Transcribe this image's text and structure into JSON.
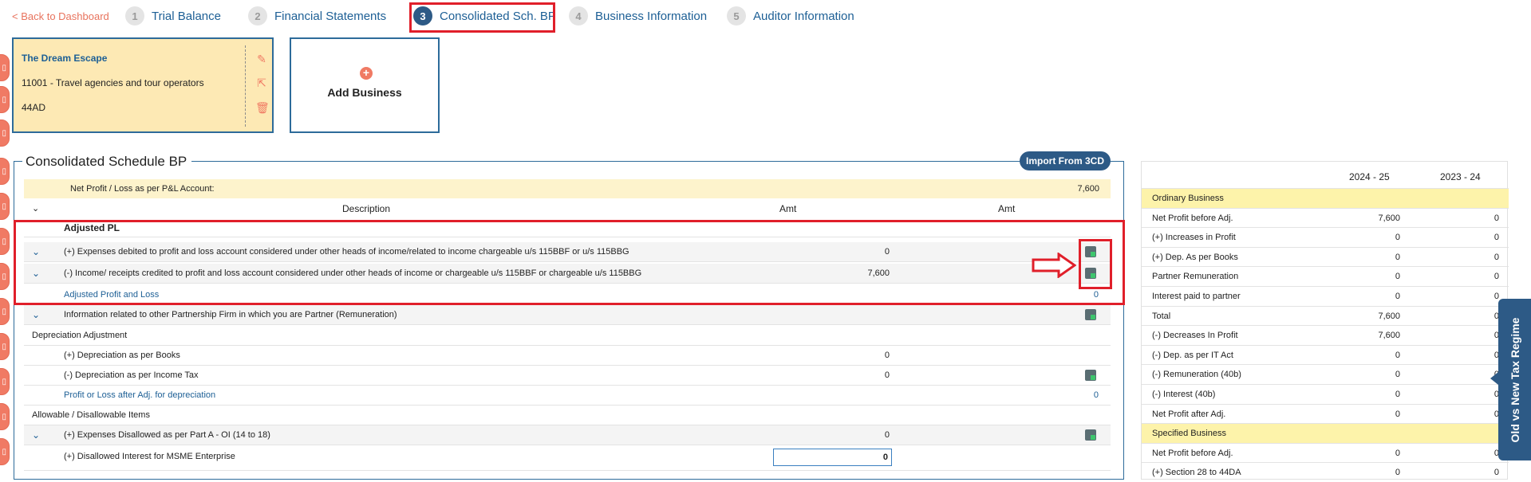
{
  "nav": {
    "back_label": "< Back to Dashboard",
    "steps": [
      {
        "num": "1",
        "label": "Trial Balance"
      },
      {
        "num": "2",
        "label": "Financial Statements"
      },
      {
        "num": "3",
        "label": "Consolidated Sch. BP"
      },
      {
        "num": "4",
        "label": "Business Information"
      },
      {
        "num": "5",
        "label": "Auditor Information"
      }
    ]
  },
  "business_card": {
    "name": "The Dream Escape",
    "code": "11001 - Travel agencies and tour operators",
    "section": "44AD"
  },
  "add_business": {
    "label": "Add Business",
    "icon": "plus-icon"
  },
  "section": {
    "title": "Consolidated Schedule BP",
    "import_label": "Import From 3CD",
    "net_profit_label": "Net Profit / Loss as per P&L Account:",
    "net_profit_value": "7,600",
    "col_description": "Description",
    "col_amt1": "Amt",
    "col_amt2": "Amt",
    "rows": [
      {
        "text": "Adjusted PL",
        "amt1": "",
        "amt2": ""
      },
      {
        "text": "(+) Expenses debited to profit and loss account considered under other heads of income/related to income chargeable u/s 115BBF or u/s 115BBG",
        "amt1": "0",
        "amt2": ""
      },
      {
        "text": "(-) Income/ receipts credited to profit and loss account considered under other heads of income or chargeable u/s 115BBF or chargeable u/s 115BBG",
        "amt1": "7,600",
        "amt2": ""
      },
      {
        "text": "Adjusted Profit and Loss",
        "amt1": "",
        "amt2": "0"
      },
      {
        "text": "Information related to other Partnership Firm in which you are Partner (Remuneration)",
        "amt1": "",
        "amt2": ""
      },
      {
        "text": "Depreciation Adjustment",
        "amt1": "",
        "amt2": ""
      },
      {
        "text": "(+) Depreciation as per Books",
        "amt1": "0",
        "amt2": ""
      },
      {
        "text": "(-) Depreciation as per Income Tax",
        "amt1": "0",
        "amt2": ""
      },
      {
        "text": "Profit or Loss after Adj. for depreciation",
        "amt1": "",
        "amt2": "0"
      },
      {
        "text": "Allowable / Disallowable Items",
        "amt1": "",
        "amt2": ""
      },
      {
        "text": "(+) Expenses Disallowed as per Part A - OI (14 to 18)",
        "amt1": "0",
        "amt2": ""
      },
      {
        "text": "(+) Disallowed Interest for MSME Enterprise",
        "amt1": "0",
        "amt2": ""
      }
    ]
  },
  "summary": {
    "col1": "2024 - 25",
    "col2": "2023 - 24",
    "rows": [
      {
        "label": "Ordinary Business",
        "v1": "",
        "v2": ""
      },
      {
        "label": "Net Profit before Adj.",
        "v1": "7,600",
        "v2": "0"
      },
      {
        "label": "(+) Increases in Profit",
        "v1": "0",
        "v2": "0"
      },
      {
        "label": "(+) Dep. As per Books",
        "v1": "0",
        "v2": "0"
      },
      {
        "label": "Partner Remuneration",
        "v1": "0",
        "v2": "0"
      },
      {
        "label": "Interest paid to partner",
        "v1": "0",
        "v2": "0"
      },
      {
        "label": "Total",
        "v1": "7,600",
        "v2": "0"
      },
      {
        "label": "(-) Decreases In Profit",
        "v1": "7,600",
        "v2": "0"
      },
      {
        "label": "(-) Dep. as per IT Act",
        "v1": "0",
        "v2": "0"
      },
      {
        "label": "(-) Remuneration (40b)",
        "v1": "0",
        "v2": "0"
      },
      {
        "label": "(-) Interest (40b)",
        "v1": "0",
        "v2": "0"
      },
      {
        "label": "Net Profit after Adj.",
        "v1": "0",
        "v2": "0"
      },
      {
        "label": "Specified Business",
        "v1": "",
        "v2": ""
      },
      {
        "label": "Net Profit before Adj.",
        "v1": "0",
        "v2": "0"
      },
      {
        "label": "(+) Section 28 to 44DA",
        "v1": "0",
        "v2": "0"
      }
    ]
  },
  "regime_tab": "Old vs New Tax Regime",
  "colors": {
    "accent": "#2d5a86",
    "link": "#1d5f95",
    "highlight": "#e01f2a",
    "card": "#fde9b4",
    "side": "#f07a64"
  }
}
